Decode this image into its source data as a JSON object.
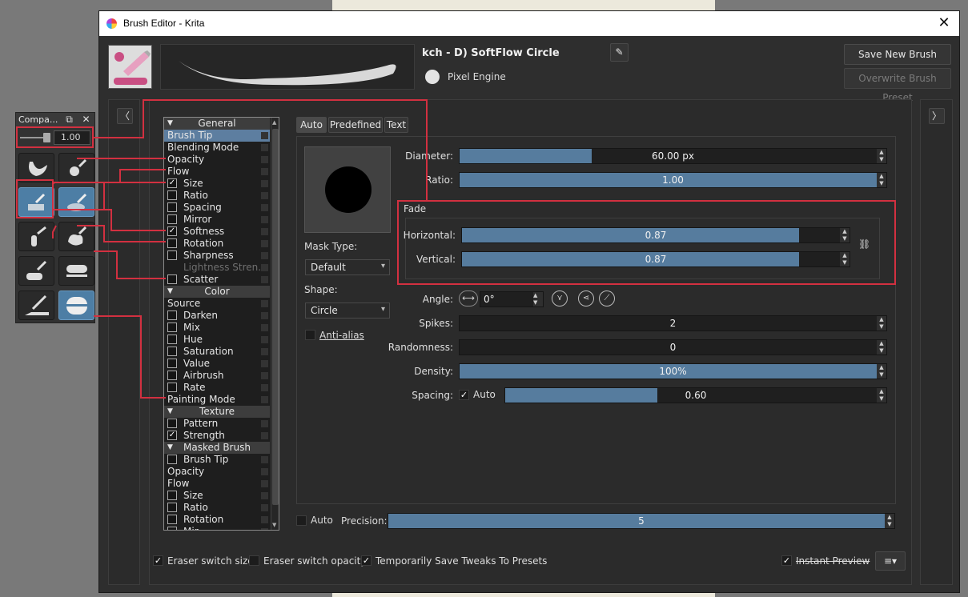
{
  "window": {
    "title": "Brush Editor - Krita",
    "close": "✕"
  },
  "compact": {
    "title": "Compa...",
    "value": "1.00"
  },
  "header": {
    "preset_name": "kch - D) SoftFlow Circle",
    "engine": "Pixel Engine",
    "save_new": "Save New Brush Preset...",
    "overwrite": "Overwrite Brush Preset"
  },
  "options": [
    {
      "label": "General",
      "type": "header"
    },
    {
      "label": "Brush Tip",
      "type": "selected"
    },
    {
      "label": "Blending Mode",
      "type": "plain"
    },
    {
      "label": "Opacity",
      "type": "plain"
    },
    {
      "label": "Flow",
      "type": "plain"
    },
    {
      "label": "Size",
      "type": "check",
      "checked": true
    },
    {
      "label": "Ratio",
      "type": "check",
      "checked": false
    },
    {
      "label": "Spacing",
      "type": "check",
      "checked": false
    },
    {
      "label": "Mirror",
      "type": "check",
      "checked": false
    },
    {
      "label": "Softness",
      "type": "check",
      "checked": true
    },
    {
      "label": "Rotation",
      "type": "check",
      "checked": false
    },
    {
      "label": "Sharpness",
      "type": "check",
      "checked": false
    },
    {
      "label": "Lightness Stren...",
      "type": "dim"
    },
    {
      "label": "Scatter",
      "type": "check",
      "checked": false
    },
    {
      "label": "Color",
      "type": "header"
    },
    {
      "label": "Source",
      "type": "plain"
    },
    {
      "label": "Darken",
      "type": "check",
      "checked": false
    },
    {
      "label": "Mix",
      "type": "check",
      "checked": false
    },
    {
      "label": "Hue",
      "type": "check",
      "checked": false
    },
    {
      "label": "Saturation",
      "type": "check",
      "checked": false
    },
    {
      "label": "Value",
      "type": "check",
      "checked": false
    },
    {
      "label": "Airbrush",
      "type": "check",
      "checked": false
    },
    {
      "label": "Rate",
      "type": "check",
      "checked": false
    },
    {
      "label": "Painting Mode",
      "type": "plain"
    },
    {
      "label": "Texture",
      "type": "header"
    },
    {
      "label": "Pattern",
      "type": "check",
      "checked": false
    },
    {
      "label": "Strength",
      "type": "check",
      "checked": true
    },
    {
      "label": "Masked Brush",
      "type": "header"
    },
    {
      "label": "Brush Tip",
      "type": "check",
      "checked": false
    },
    {
      "label": "Opacity",
      "type": "plain"
    },
    {
      "label": "Flow",
      "type": "plain"
    },
    {
      "label": "Size",
      "type": "check",
      "checked": false
    },
    {
      "label": "Ratio",
      "type": "check",
      "checked": false
    },
    {
      "label": "Rotation",
      "type": "check",
      "checked": false
    },
    {
      "label": "Mir...",
      "type": "check",
      "checked": false
    }
  ],
  "tabs": [
    "Auto",
    "Predefined",
    "Text"
  ],
  "tip": {
    "mask_type_label": "Mask Type:",
    "mask_type": "Default",
    "shape_label": "Shape:",
    "shape": "Circle",
    "antialias": "Anti-alias",
    "diameter_label": "Diameter:",
    "diameter": "60.00 px",
    "diameter_fill": 0.31,
    "ratio_label": "Ratio:",
    "ratio": "1.00",
    "ratio_fill": 1.0,
    "fade_title": "Fade",
    "horizontal_label": "Horizontal:",
    "horizontal": "0.87",
    "horizontal_fill": 0.87,
    "vertical_label": "Vertical:",
    "vertical": "0.87",
    "vertical_fill": 0.87,
    "angle_label": "Angle:",
    "angle": "0°",
    "spikes_label": "Spikes:",
    "spikes": "2",
    "randomness_label": "Randomness:",
    "randomness": "0",
    "density_label": "Density:",
    "density": "100%",
    "density_fill": 1.0,
    "spacing_label": "Spacing:",
    "spacing_auto": "Auto",
    "spacing": "0.60",
    "spacing_fill": 0.4,
    "precision_auto": "Auto",
    "precision_label": "Precision:",
    "precision": "5",
    "precision_fill": 1.0
  },
  "footer": {
    "eraser_size": "Eraser switch size",
    "eraser_opacity": "Eraser switch opacity",
    "temp_save": "Temporarily Save Tweaks To Presets",
    "instant_preview": "Instant Preview"
  },
  "colors": {
    "accent": "#567c9e",
    "annotation": "#d23040"
  }
}
